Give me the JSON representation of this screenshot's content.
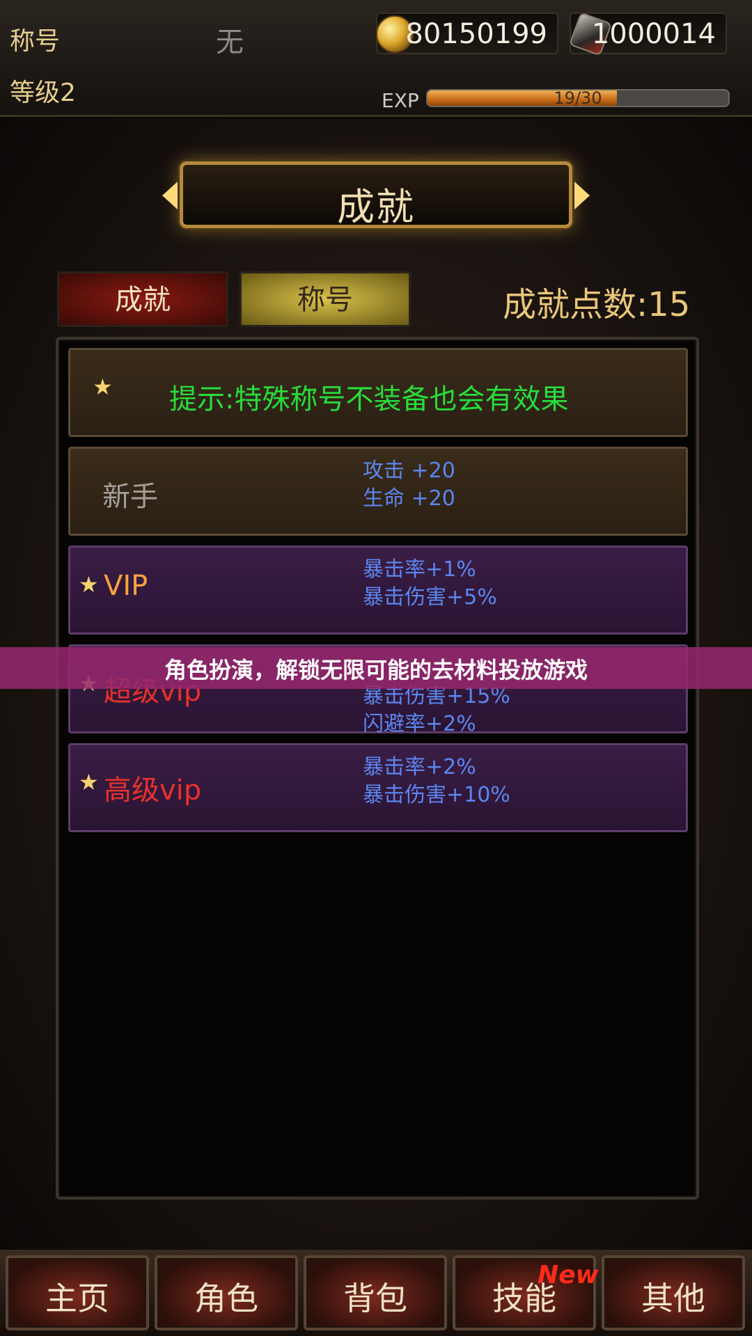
{
  "top": {
    "title_label": "称号",
    "title_value": "无",
    "level_label": "等级2",
    "gold": "80150199",
    "gems": "1000014",
    "exp_label": "EXP",
    "exp_text": "19/30",
    "exp_progress": 0.63
  },
  "banner": {
    "title": "成就"
  },
  "tabs": {
    "achievement": "成就",
    "title": "称号"
  },
  "points": "成就点数:15",
  "rows": [
    {
      "hint": "提示:特殊称号不装备也会有效果"
    },
    {
      "name": "新手",
      "bonus1": "攻击 +20",
      "bonus2": "生命 +20"
    },
    {
      "name": "VIP",
      "bonus1": "暴击率+1%",
      "bonus2": "暴击伤害+5%"
    },
    {
      "name": "超级vip",
      "bonus1": "暴击伤害+15%",
      "bonus2": "闪避率+2%"
    },
    {
      "name": "高级vip",
      "bonus1": "暴击率+2%",
      "bonus2": "暴击伤害+10%"
    }
  ],
  "overlay": "角色扮演，解锁无限可能的去材料投放游戏",
  "nav": {
    "home": "主页",
    "character": "角色",
    "bag": "背包",
    "skills": "技能",
    "other": "其他",
    "new_badge": "New"
  },
  "colors": {
    "hint_green": "#27dd3b",
    "bonus_blue": "#5c86f0",
    "vip_orange": "#f7a23d",
    "svip_red": "#e8312b",
    "overlay_magenta": "#96286e"
  },
  "icons": {
    "gold": "gold-coin-icon",
    "gems": "gem-icon",
    "star": "star-icon"
  }
}
